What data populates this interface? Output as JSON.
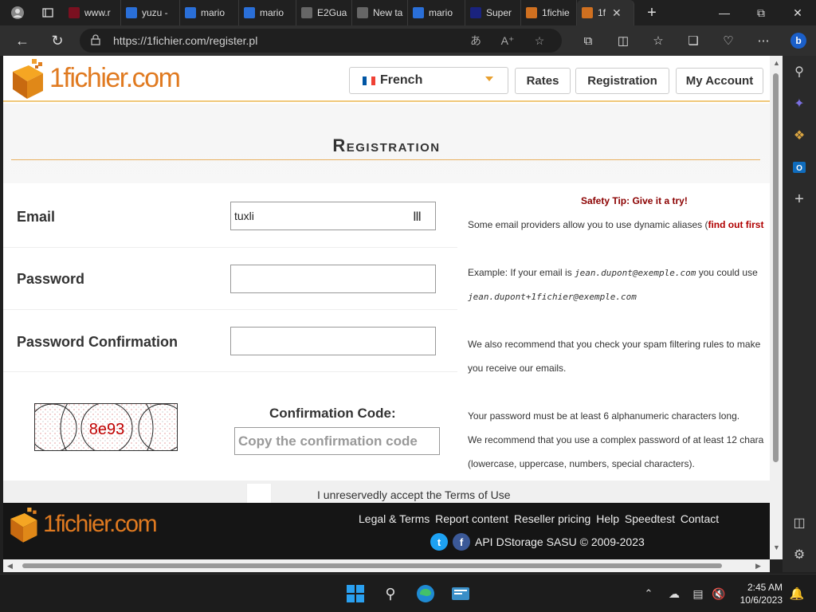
{
  "browser": {
    "tabs": [
      {
        "label": "www.r",
        "favicon_color": "#7a1020"
      },
      {
        "label": "yuzu -",
        "favicon_color": "#2a6fd8"
      },
      {
        "label": "mario",
        "favicon_color": "#2a6fd8"
      },
      {
        "label": "mario",
        "favicon_color": "#2a6fd8"
      },
      {
        "label": "E2Gua",
        "favicon_color": "#666666"
      },
      {
        "label": "New ta",
        "favicon_color": "#666666"
      },
      {
        "label": "mario",
        "favicon_color": "#2a6fd8"
      },
      {
        "label": "Super",
        "favicon_color": "#1a237e"
      },
      {
        "label": "1fichie",
        "favicon_color": "#d07020"
      },
      {
        "label": "1f",
        "favicon_color": "#d07020",
        "active": true
      }
    ],
    "url": "https://1fichier.com/register.pl"
  },
  "site": {
    "logo_text": "1fichier.com",
    "language": "French",
    "nav": {
      "rates": "Rates",
      "registration": "Registration",
      "my_account": "My Account"
    },
    "title": "Registration",
    "form": {
      "email_label": "Email",
      "email_value": "tuxli",
      "password_label": "Password",
      "password_confirm_label": "Password Confirmation",
      "captcha_text": "8e93",
      "confirmation_label": "Confirmation Code:",
      "confirmation_placeholder": "Copy the confirmation code",
      "terms_text": "I unreservedly accept the Terms of Use"
    },
    "tips": {
      "safety_title": "Safety Tip: Give it a try!",
      "line1": "Some email providers allow you to use dynamic aliases (",
      "line1_link": "find out first",
      "line2_prefix": "Example: If your email is ",
      "line2_email": "jean.dupont@exemple.com",
      "line2_suffix": " you could use",
      "line3_email": "jean.dupont+1fichier@exemple.com",
      "line4": "We also recommend that you check your spam filtering rules to make",
      "line5": "you receive our emails.",
      "line6": "Your password must be at least 6 alphanumeric characters long.",
      "line7": "We recommend that you use a complex password of at least 12 chara",
      "line8": "(lowercase, uppercase, numbers, special characters)."
    },
    "footer": {
      "links": [
        "Legal & Terms",
        "Report content",
        "Reseller pricing",
        "Help",
        "Speedtest",
        "Contact"
      ],
      "bottom_links": [
        "API",
        "DStorage SASU © 2009-2023"
      ]
    }
  },
  "taskbar": {
    "time": "2:45 AM",
    "date": "10/6/2023"
  }
}
